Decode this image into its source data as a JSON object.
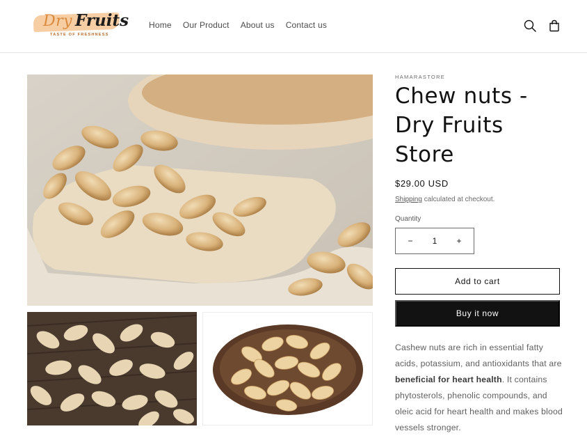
{
  "header": {
    "logo": {
      "word1": "Dry",
      "word2": "Fruits",
      "tagline": "TASTE OF FRESHNESS"
    },
    "nav": [
      "Home",
      "Our Product",
      "About us",
      "Contact us"
    ],
    "icons": {
      "search": "search-icon",
      "cart": "cart-icon"
    }
  },
  "gallery": {
    "images": [
      "cashews-in-wooden-tray",
      "cashews-on-wooden-table",
      "cashews-in-brown-bowl"
    ]
  },
  "product": {
    "vendor": "HAMARASTORE",
    "title": "Chew nuts - Dry Fruits Store",
    "price": "$29.00 USD",
    "shipping_link": "Shipping",
    "shipping_text": " calculated at checkout.",
    "quantity_label": "Quantity",
    "quantity_value": "1",
    "minus": "−",
    "plus": "+",
    "add_to_cart": "Add to cart",
    "buy_now": "Buy it now",
    "description": {
      "part1": "Cashew nuts are rich in essential fatty acids, potassium, and antioxidants that are ",
      "bold": "beneficial for heart health",
      "part2": ". It contains phytosterols, phenolic compounds, and oleic acid for heart health and makes blood vessels stronger."
    }
  },
  "colors": {
    "text": "#121212",
    "muted": "#6b6b6b",
    "button_dark": "#121212",
    "logo_swash": "#f6c99a",
    "logo_orange": "#d98a3c"
  }
}
